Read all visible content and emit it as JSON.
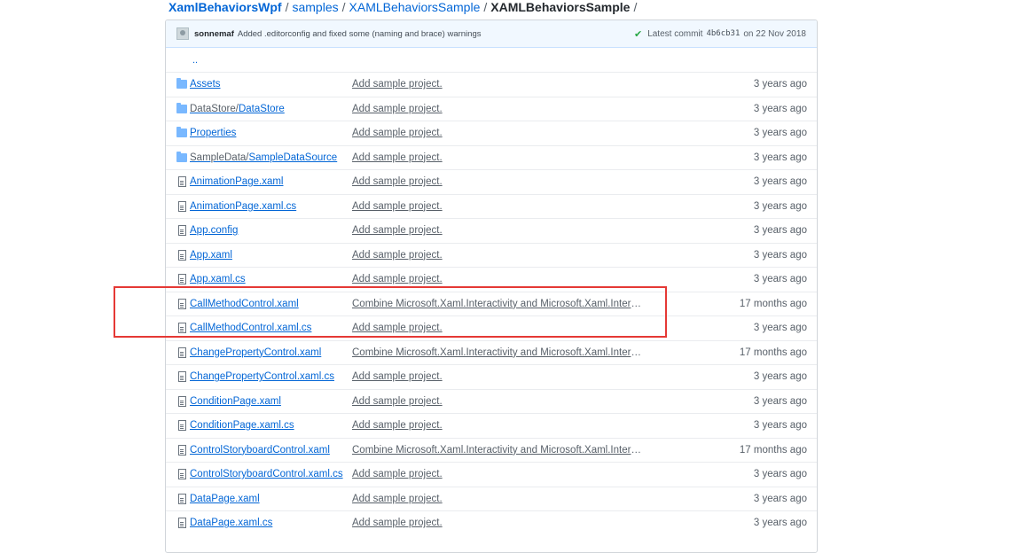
{
  "breadcrumb": {
    "root": "XamlBehaviorsWpf",
    "sep": "/",
    "items": [
      "samples",
      "XAMLBehaviorsSample"
    ],
    "current": "XAMLBehaviorsSample"
  },
  "commit": {
    "author": "sonnemaf",
    "message": "Added .editorconfig and fixed some (naming and brace) warnings",
    "latest_label": "Latest commit",
    "sha": "4b6cb31",
    "date": "on 22 Nov 2018"
  },
  "up_dir": "..",
  "files": [
    {
      "type": "folder",
      "name": "Assets",
      "msg": "Add sample project.",
      "age": "3 years ago"
    },
    {
      "type": "folder",
      "name_dim": "DataStore/",
      "name": "DataStore",
      "msg": "Add sample project.",
      "age": "3 years ago"
    },
    {
      "type": "folder",
      "name": "Properties",
      "msg": "Add sample project.",
      "age": "3 years ago"
    },
    {
      "type": "folder",
      "name_dim": "SampleData/",
      "name": "SampleDataSource",
      "msg": "Add sample project.",
      "age": "3 years ago"
    },
    {
      "type": "file",
      "name": "AnimationPage.xaml",
      "msg": "Add sample project.",
      "age": "3 years ago"
    },
    {
      "type": "file",
      "name": "AnimationPage.xaml.cs",
      "msg": "Add sample project.",
      "age": "3 years ago"
    },
    {
      "type": "file",
      "name": "App.config",
      "msg": "Add sample project.",
      "age": "3 years ago"
    },
    {
      "type": "file",
      "name": "App.xaml",
      "msg": "Add sample project.",
      "age": "3 years ago"
    },
    {
      "type": "file",
      "name": "App.xaml.cs",
      "msg": "Add sample project.",
      "age": "3 years ago"
    },
    {
      "type": "file",
      "name": "CallMethodControl.xaml",
      "msg": "Combine Microsoft.Xaml.Interactivity and Microsoft.Xaml.Interaction d…",
      "age": "17 months ago"
    },
    {
      "type": "file",
      "name": "CallMethodControl.xaml.cs",
      "msg": "Add sample project.",
      "age": "3 years ago"
    },
    {
      "type": "file",
      "name": "ChangePropertyControl.xaml",
      "msg": "Combine Microsoft.Xaml.Interactivity and Microsoft.Xaml.Interaction d…",
      "age": "17 months ago"
    },
    {
      "type": "file",
      "name": "ChangePropertyControl.xaml.cs",
      "msg": "Add sample project.",
      "age": "3 years ago"
    },
    {
      "type": "file",
      "name": "ConditionPage.xaml",
      "msg": "Add sample project.",
      "age": "3 years ago"
    },
    {
      "type": "file",
      "name": "ConditionPage.xaml.cs",
      "msg": "Add sample project.",
      "age": "3 years ago"
    },
    {
      "type": "file",
      "name": "ControlStoryboardControl.xaml",
      "msg": "Combine Microsoft.Xaml.Interactivity and Microsoft.Xaml.Interaction d…",
      "age": "17 months ago"
    },
    {
      "type": "file",
      "name": "ControlStoryboardControl.xaml.cs",
      "msg": "Add sample project.",
      "age": "3 years ago"
    },
    {
      "type": "file",
      "name": "DataPage.xaml",
      "msg": "Add sample project.",
      "age": "3 years ago"
    },
    {
      "type": "file",
      "name": "DataPage.xaml.cs",
      "msg": "Add sample project.",
      "age": "3 years ago"
    }
  ],
  "colors": {
    "link": "#0366d6",
    "highlight": "#e53935",
    "commit_bg": "#f1f8ff"
  }
}
